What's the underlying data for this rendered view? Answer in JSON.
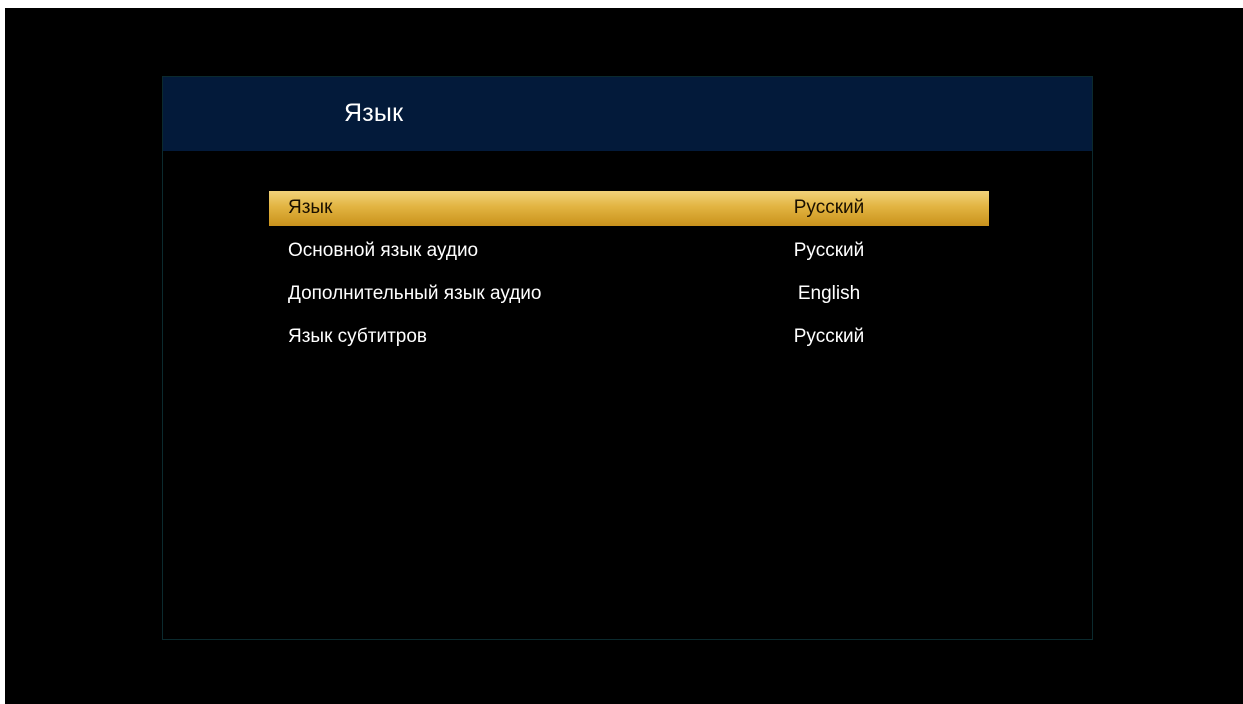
{
  "panel": {
    "title": "Язык"
  },
  "menu": {
    "items": [
      {
        "label": "Язык",
        "value": "Русский",
        "selected": true
      },
      {
        "label": "Основной язык аудио",
        "value": "Русский",
        "selected": false
      },
      {
        "label": "Дополнительный язык аудио",
        "value": "English",
        "selected": false
      },
      {
        "label": "Язык субтитров",
        "value": "Русский",
        "selected": false
      }
    ]
  },
  "colors": {
    "screen_background": "#000000",
    "header_background": "#031a3a",
    "selection_highlight": "#e2b441",
    "text": "#ffffff"
  }
}
